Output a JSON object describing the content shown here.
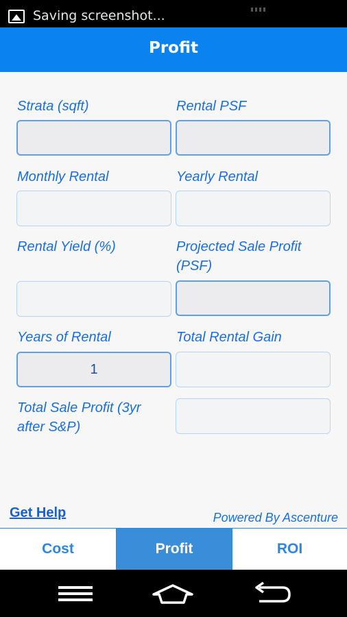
{
  "status_bar": {
    "notification_text": "Saving screenshot..."
  },
  "header": {
    "title": "Profit"
  },
  "form": {
    "strata_label": "Strata (sqft)",
    "strata_value": "",
    "rental_psf_label": "Rental PSF",
    "rental_psf_value": "",
    "monthly_rental_label": "Monthly Rental",
    "monthly_rental_value": "",
    "yearly_rental_label": "Yearly Rental",
    "yearly_rental_value": "",
    "rental_yield_label": "Rental Yield (%)",
    "rental_yield_value": "",
    "projected_sale_profit_label": "Projected Sale Profit (PSF)",
    "projected_sale_profit_value": "",
    "years_of_rental_label": "Years of Rental",
    "years_of_rental_value": "1",
    "total_rental_gain_label": "Total Rental Gain",
    "total_rental_gain_value": "",
    "total_sale_profit_label": "Total Sale Profit (3yr after S&P)",
    "total_sale_profit_value": ""
  },
  "footer": {
    "help_link": "Get Help",
    "powered_by": "Powered By Ascenture"
  },
  "tabs": [
    {
      "label": "Cost",
      "active": false
    },
    {
      "label": "Profit",
      "active": true
    },
    {
      "label": "ROI",
      "active": false
    }
  ],
  "nav_bar": {
    "icons": [
      "menu-icon",
      "home-icon",
      "back-icon"
    ]
  },
  "colors": {
    "accent": "#0a82f0",
    "label_blue": "#1a6fe0",
    "tab_active": "#3a8ed9"
  }
}
